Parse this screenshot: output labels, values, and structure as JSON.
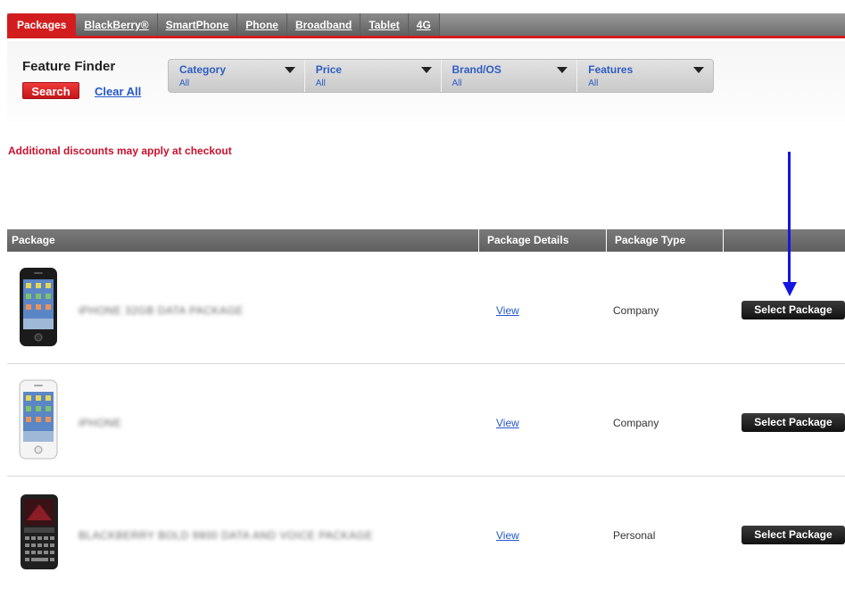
{
  "tabs": [
    {
      "label": "Packages",
      "active": true
    },
    {
      "label": "BlackBerry®",
      "active": false
    },
    {
      "label": "SmartPhone",
      "active": false
    },
    {
      "label": "Phone",
      "active": false
    },
    {
      "label": "Broadband",
      "active": false
    },
    {
      "label": "Tablet",
      "active": false
    },
    {
      "label": "4G",
      "active": false
    }
  ],
  "finder": {
    "title": "Feature Finder",
    "search_label": "Search",
    "clear_label": "Clear All",
    "filters": [
      {
        "label": "Category",
        "value": "All"
      },
      {
        "label": "Price",
        "value": "All"
      },
      {
        "label": "Brand/OS",
        "value": "All"
      },
      {
        "label": "Features",
        "value": "All"
      }
    ]
  },
  "notice": "Additional discounts may apply at checkout",
  "table": {
    "headers": {
      "package": "Package",
      "details": "Package Details",
      "type": "Package Type",
      "action": ""
    },
    "rows": [
      {
        "name": "iPHONE 32GB DATA PACKAGE",
        "details": "View",
        "type": "Company",
        "action": "Select Package",
        "icon": "black-smartphone-icon"
      },
      {
        "name": "iPHONE",
        "details": "View",
        "type": "Company",
        "action": "Select Package",
        "icon": "white-smartphone-icon"
      },
      {
        "name": "BLACKBERRY BOLD 9900 DATA AND VOICE PACKAGE",
        "details": "View",
        "type": "Personal",
        "action": "Select Package",
        "icon": "blackberry-phone-icon"
      }
    ]
  },
  "colors": {
    "accent": "#d21d1f",
    "link": "#2458c8",
    "annotation_arrow": "#1616e0"
  }
}
